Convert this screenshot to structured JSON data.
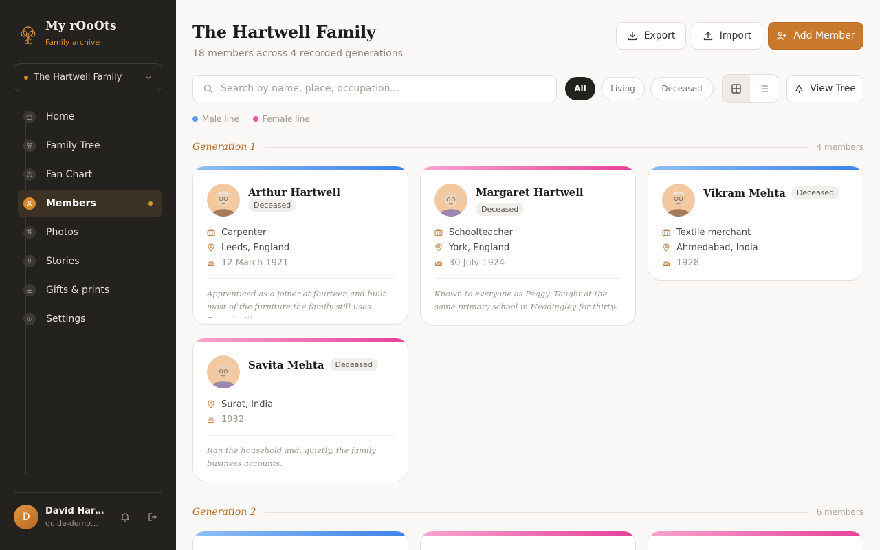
{
  "brand": {
    "name": "My rOoOts",
    "subtitle": "Family archive"
  },
  "family_selector": {
    "value": "The Hartwell Family"
  },
  "nav": {
    "items": [
      {
        "label": "Home",
        "icon": "home-icon"
      },
      {
        "label": "Family Tree",
        "icon": "tree-icon"
      },
      {
        "label": "Fan Chart",
        "icon": "fan-chart-icon"
      },
      {
        "label": "Members",
        "icon": "members-icon",
        "active": true
      },
      {
        "label": "Photos",
        "icon": "photos-icon"
      },
      {
        "label": "Stories",
        "icon": "mic-icon"
      },
      {
        "label": "Gifts & prints",
        "icon": "gift-icon"
      },
      {
        "label": "Settings",
        "icon": "gear-icon"
      }
    ]
  },
  "user": {
    "initial": "D",
    "name": "David Hartwell",
    "email": "guide-demo@myroots.app"
  },
  "header": {
    "title": "The Hartwell Family",
    "subtitle": "18 members across 4 recorded generations",
    "export_label": "Export",
    "import_label": "Import",
    "add_label": "Add Member"
  },
  "search": {
    "placeholder": "Search by name, place, occupation...",
    "value": ""
  },
  "filters": {
    "all": "All",
    "living": "Living",
    "deceased": "Deceased",
    "selected": "All"
  },
  "view_tree_label": "View Tree",
  "legend": {
    "male": "Male line",
    "female": "Female line"
  },
  "colors": {
    "accent": "#c9792b",
    "male": "#3d82e8",
    "female": "#e6409a",
    "sidebar": "#23221f"
  },
  "generations": [
    {
      "title": "Generation 1",
      "count": "4 members",
      "members": [
        {
          "name": "Arthur Hartwell",
          "status": "Deceased",
          "line": "male",
          "occupation": "Carpenter",
          "place": "Leeds, England",
          "born": "12 March 1921",
          "bio": "Apprenticed as a joiner at fourteen and built most of the furniture the family still uses. Served with..."
        },
        {
          "name": "Margaret Hartwell",
          "status": "Deceased",
          "line": "female",
          "occupation": "Schoolteacher",
          "place": "York, England",
          "born": "30 July 1924",
          "bio": "Known to everyone as Peggy. Taught at the same primary school in Headingley for thirty-one years."
        },
        {
          "name": "Vikram Mehta",
          "status": "Deceased",
          "line": "male",
          "occupation": "Textile merchant",
          "place": "Ahmedabad, India",
          "born": "1928",
          "bio": ""
        },
        {
          "name": "Savita Mehta",
          "status": "Deceased",
          "line": "female",
          "occupation": "",
          "place": "Surat, India",
          "born": "1932",
          "bio": "Ran the household and, quietly, the family business accounts."
        }
      ]
    },
    {
      "title": "Generation 2",
      "count": "6 members"
    }
  ]
}
